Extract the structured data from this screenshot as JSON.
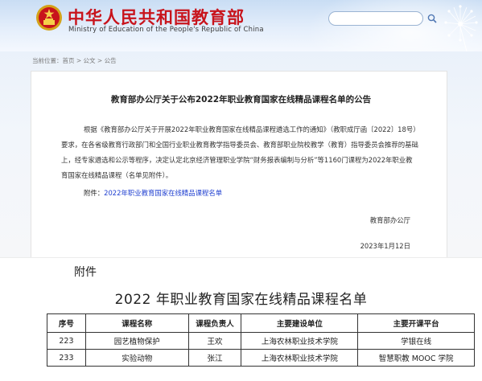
{
  "header": {
    "site_title": "中华人民共和国教育部",
    "site_subtitle": "Ministry of Education of the People's Republic of China"
  },
  "breadcrumb": "当前位置：首页 > 公文 > 公告",
  "notice": {
    "title": "教育部办公厅关于公布2022年职业教育国家在线精品课程名单的公告",
    "body": "根据《教育部办公厅关于开展2022年职业教育国家在线精品课程遴选工作的通知》（教职成厅函〔2022〕18号）要求，在各省级教育行政部门和全国行业职业教育教学指导委员会、教育部职业院校教学（教育）指导委员会推荐的基础上，经专家遴选和公示等程序，决定认定北京经济管理职业学院“财务报表编制与分析”等1160门课程为2022年职业教育国家在线精品课程（名单见附件）。",
    "attachment_prefix": "附件：",
    "attachment_link": "2022年职业教育国家在线精品课程名单",
    "signer": "教育部办公厅",
    "date": "2023年1月12日"
  },
  "document": {
    "label": "附件",
    "title": "2022 年职业教育国家在线精品课程名单",
    "table": {
      "headers": [
        "序号",
        "课程名称",
        "课程负责人",
        "主要建设单位",
        "主要开课平台"
      ],
      "rows": [
        [
          "223",
          "园艺植物保护",
          "王欢",
          "上海农林职业技术学院",
          "学银在线"
        ],
        [
          "233",
          "实验动物",
          "张江",
          "上海农林职业技术学院",
          "智慧职教 MOOC 学院"
        ]
      ]
    }
  },
  "colors": {
    "title_red": "#c8141c",
    "link_blue": "#1f3fd0",
    "banner_blue": "#c9ddf4"
  },
  "icons": [
    "national-emblem-icon",
    "search-icon",
    "dandelion-decoration"
  ]
}
